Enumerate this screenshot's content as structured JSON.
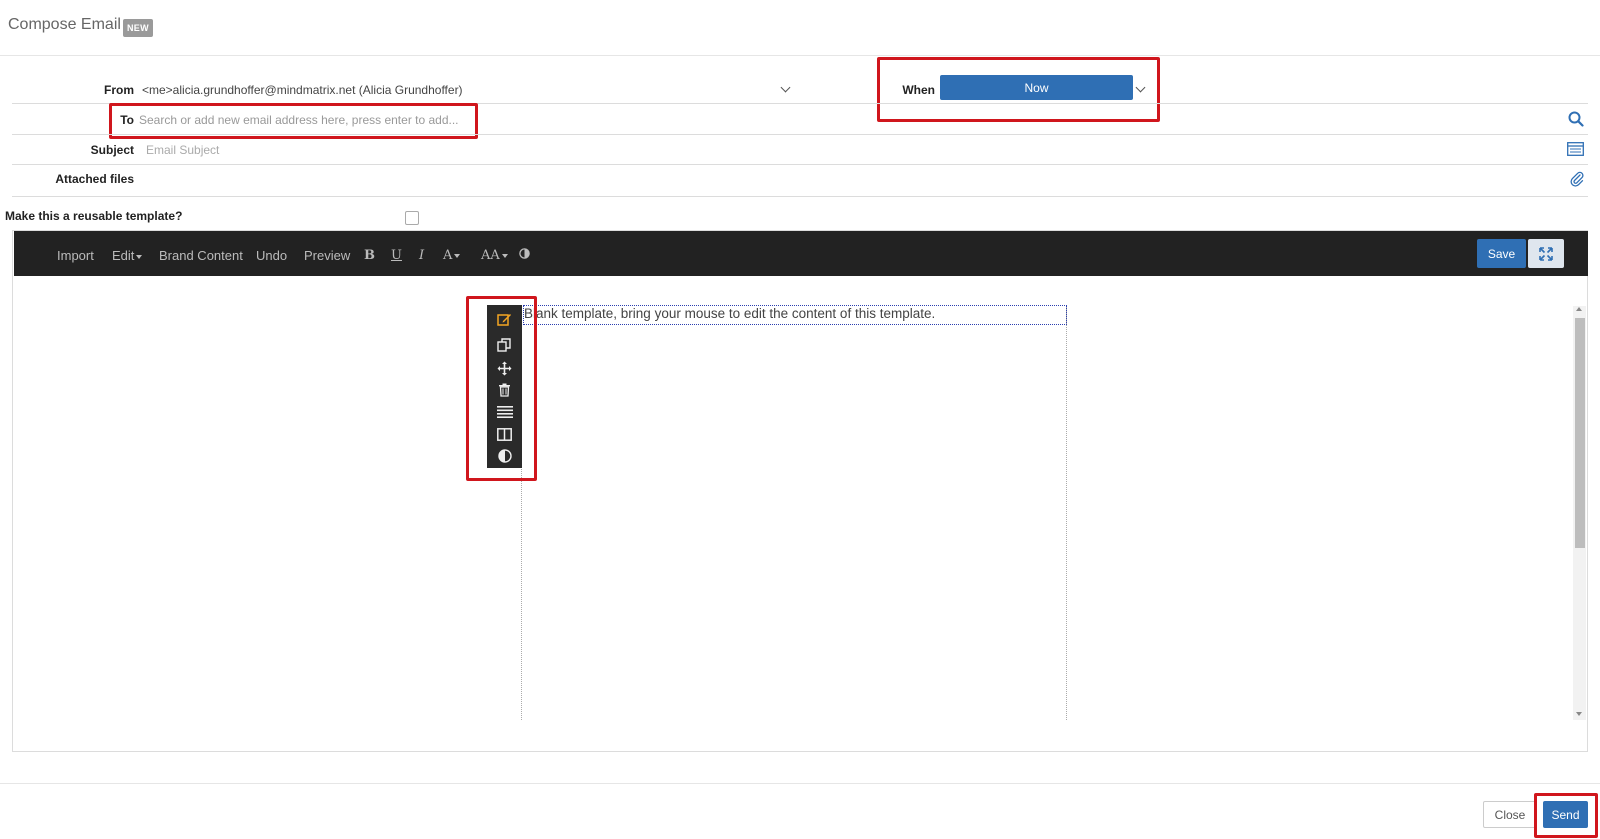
{
  "header": {
    "title": "Compose Email",
    "badge": "NEW"
  },
  "form": {
    "from_label": "From",
    "from_value": "<me>alicia.grundhoffer@mindmatrix.net (Alicia Grundhoffer)",
    "when_label": "When",
    "when_value": "Now",
    "to_label": "To",
    "to_placeholder": "Search or add new email address here, press enter to add...",
    "subject_label": "Subject",
    "subject_placeholder": "Email Subject",
    "attached_label": "Attached files",
    "template_label": "Make this a reusable template?",
    "template_checked": false
  },
  "toolbar": {
    "items": [
      "Import",
      "Edit",
      "Brand Content",
      "Undo",
      "Preview"
    ],
    "bold": "B",
    "underline": "U",
    "italic": "I",
    "font_color": "A",
    "font_size": "AA",
    "save_label": "Save"
  },
  "canvas": {
    "block_text": "Blank template, bring your mouse to edit the content of this template."
  },
  "footer": {
    "close_label": "Close",
    "send_label": "Send"
  },
  "colors": {
    "primary": "#2f6fb4",
    "highlight": "#d0161d",
    "toolbar_bg": "#222222",
    "edit_icon": "#f5a623"
  }
}
